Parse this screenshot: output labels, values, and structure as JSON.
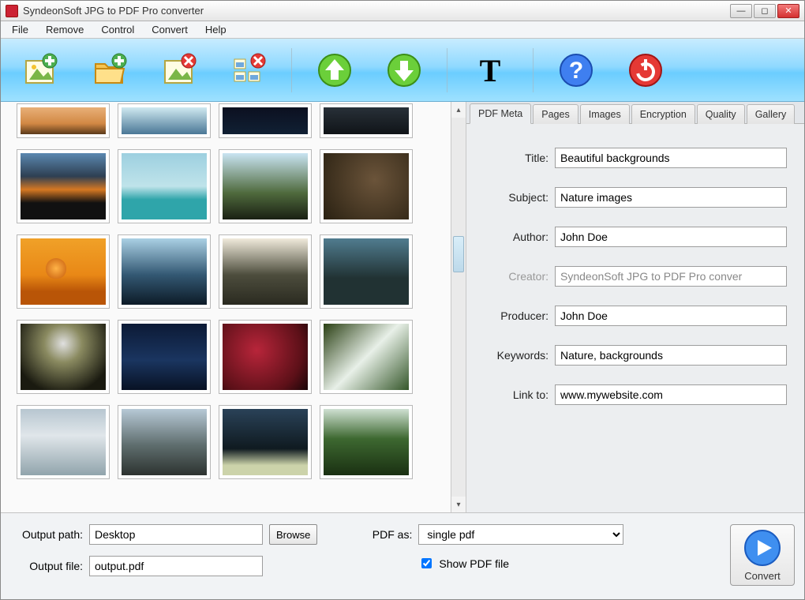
{
  "window": {
    "title": "SyndeonSoft JPG to PDF Pro converter"
  },
  "menu": {
    "items": [
      "File",
      "Remove",
      "Control",
      "Convert",
      "Help"
    ]
  },
  "toolbar": {
    "icons": [
      "add-image",
      "add-folder",
      "remove-image",
      "remove-all",
      "move-up",
      "move-down",
      "text",
      "help",
      "power"
    ]
  },
  "tabs": {
    "items": [
      "PDF Meta",
      "Pages",
      "Images",
      "Encryption",
      "Quality",
      "Gallery"
    ],
    "active": "PDF Meta"
  },
  "pdfmeta": {
    "title_label": "Title:",
    "title_value": "Beautiful backgrounds",
    "subject_label": "Subject:",
    "subject_value": "Nature images",
    "author_label": "Author:",
    "author_value": "John Doe",
    "creator_label": "Creator:",
    "creator_value": "SyndeonSoft JPG to PDF Pro conver",
    "producer_label": "Producer:",
    "producer_value": "John Doe",
    "keywords_label": "Keywords:",
    "keywords_value": "Nature, backgrounds",
    "linkto_label": "Link to:",
    "linkto_value": "www.mywebsite.com"
  },
  "bottom": {
    "output_path_label": "Output path:",
    "output_path_value": "Desktop",
    "browse_label": "Browse",
    "output_file_label": "Output file:",
    "output_file_value": "output.pdf",
    "pdfas_label": "PDF as:",
    "pdfas_value": "single pdf",
    "show_pdf_label": "Show PDF file",
    "show_pdf_checked": true,
    "convert_label": "Convert"
  }
}
